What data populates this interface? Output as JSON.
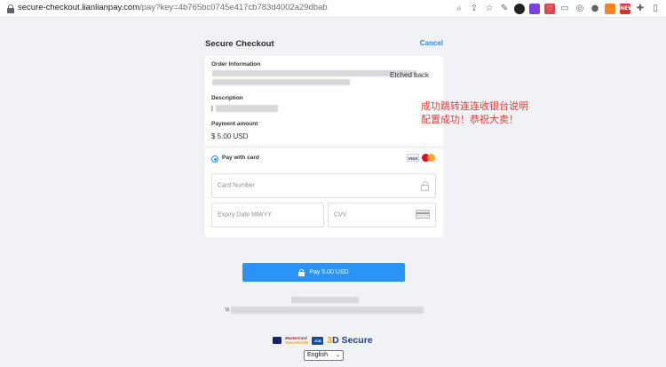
{
  "browser": {
    "url_domain": "secure-checkout.lianlianpay.com",
    "url_path": "/pay?key=4b765bc0745e417cb783d4002a29dbab"
  },
  "checkout": {
    "title": "Secure Checkout",
    "cancel_label": "Cancel"
  },
  "order": {
    "info_label": "Order Information",
    "info_visible_text": "Etched back",
    "description_label": "Description",
    "description_visible_char": "l",
    "amount_label": "Payment amount",
    "amount_value": "$ 5.00 USD"
  },
  "payment": {
    "method_label": "Pay with card",
    "card_number_placeholder": "Card Number",
    "expiry_placeholder": "Expiry Date MM/YY",
    "cvv_placeholder": "CVV",
    "card_icons": [
      "visa-icon",
      "mastercard-icon"
    ]
  },
  "annotation": {
    "line1": "成功跳转连连收银台说明",
    "line2": "配置成功！恭祝大卖！"
  },
  "pay_button": {
    "label": "Pay  5.00 USD"
  },
  "footer": {
    "visible_prefix": "u",
    "badge_mastercard_top": "MasterCard",
    "badge_mastercard_bottom": "SecureCode",
    "badge_jcb": "JCB",
    "secure_3_label": "3",
    "secure_d_label": "D Secure",
    "language": "English"
  },
  "colors": {
    "accent": "#1890ff",
    "pay_button": "#2a93f5",
    "annotation": "#e53935",
    "background": "#f1f2f5"
  }
}
